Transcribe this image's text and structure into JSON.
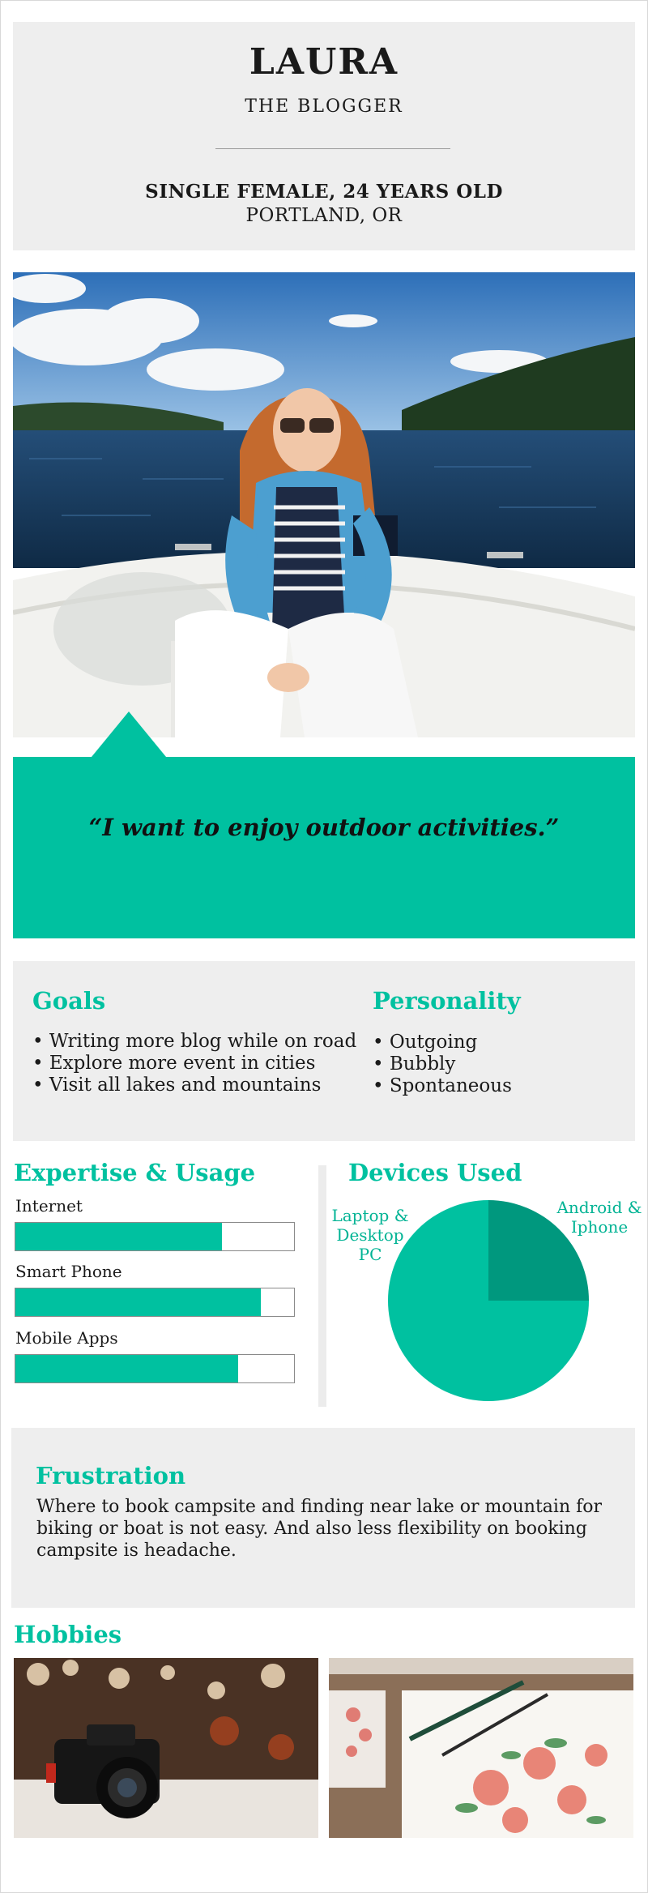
{
  "persona": {
    "name": "LAURA",
    "role": "THE BLOGGER",
    "demographic": "SINGLE FEMALE, 24 YEARS OLD",
    "location": "PORTLAND, OR"
  },
  "quote": "“I want to enjoy outdoor activities.”",
  "goals": {
    "title": "Goals",
    "items": [
      "Writing more blog while on road",
      "Explore more event in cities",
      "Visit all lakes and mountains"
    ]
  },
  "personality": {
    "title": "Personality",
    "items": [
      "Outgoing",
      "Bubbly",
      "Spontaneous"
    ]
  },
  "expertise": {
    "title": "Expertise & Usage",
    "skills": [
      {
        "label": "Internet",
        "level": 0.74
      },
      {
        "label": "Smart Phone",
        "level": 0.88
      },
      {
        "label": "Mobile Apps",
        "level": 0.8
      }
    ]
  },
  "devices": {
    "title": "Devices Used",
    "slices": [
      {
        "label": "Laptop & Desktop PC",
        "share": 0.75,
        "color": "#00c1a0"
      },
      {
        "label": "Android & Iphone",
        "share": 0.25,
        "color": "#00987e"
      }
    ]
  },
  "frustration": {
    "title": "Frustration",
    "text": "Where to book campsite and finding near lake or mountain for biking or boat is not easy. And also less flexibility on booking campsite is headache."
  },
  "hobbies": {
    "title": "Hobbies",
    "images": [
      "camera-photo",
      "watercolor-painting-photo"
    ]
  },
  "colors": {
    "accent": "#00c1a0",
    "accent_dark": "#00987e",
    "panel": "#eeeeee"
  }
}
